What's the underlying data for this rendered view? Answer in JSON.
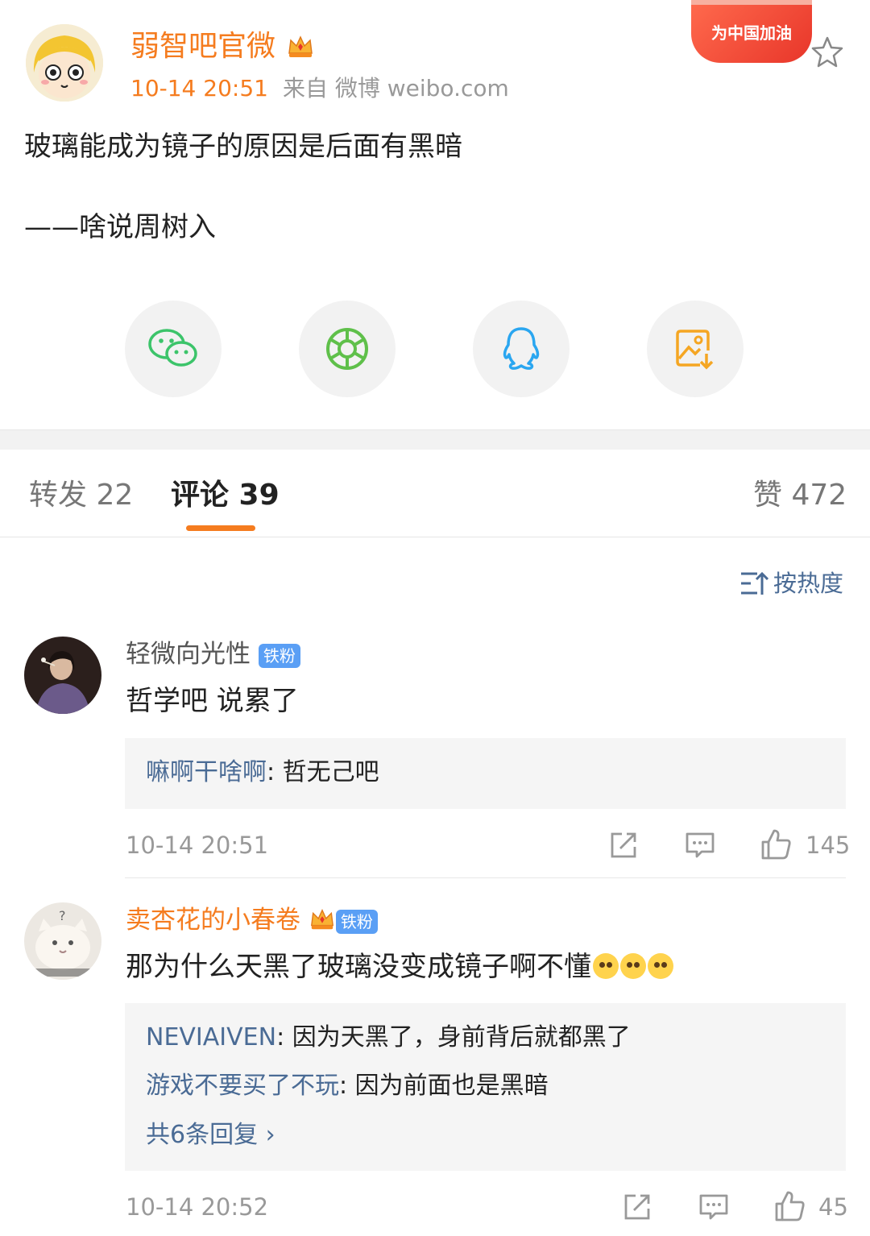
{
  "post": {
    "author": "弱智吧官微",
    "time": "10-14 20:51",
    "source": "来自 微博 weibo.com",
    "promo": "为中国加油",
    "text": "玻璃能成为镜子的原因是后面有黑暗",
    "quote": "——啥说周树入"
  },
  "share_icons": [
    "wechat-icon",
    "moments-icon",
    "qq-icon",
    "save-image-icon"
  ],
  "tabs": {
    "repost": "转发 22",
    "comment": "评论 39",
    "like": "赞 472"
  },
  "sort_label": "按热度",
  "comments": [
    {
      "user": "轻微向光性",
      "badge": "铁粉",
      "text": "哲学吧 说累了",
      "replies": [
        {
          "user": "嘛啊干啥啊",
          "text": ": 哲无己吧"
        }
      ],
      "time": "10-14 20:51",
      "likes": "145"
    },
    {
      "user": "卖杏花的小春卷",
      "badge": "铁粉",
      "text": "那为什么天黑了玻璃没变成镜子啊不懂",
      "replies": [
        {
          "user": "NEVIAIVEN",
          "text": ": 因为天黑了，身前背后就都黑了"
        },
        {
          "user": "游戏不要买了不玩",
          "text": ": 因为前面也是黑暗"
        }
      ],
      "more_replies": "共6条回复 ›",
      "time": "10-14 20:52",
      "likes": "45"
    }
  ],
  "colors": {
    "accent": "#f57c1f",
    "link": "#4a6b95",
    "badge": "#5a9ff5"
  }
}
